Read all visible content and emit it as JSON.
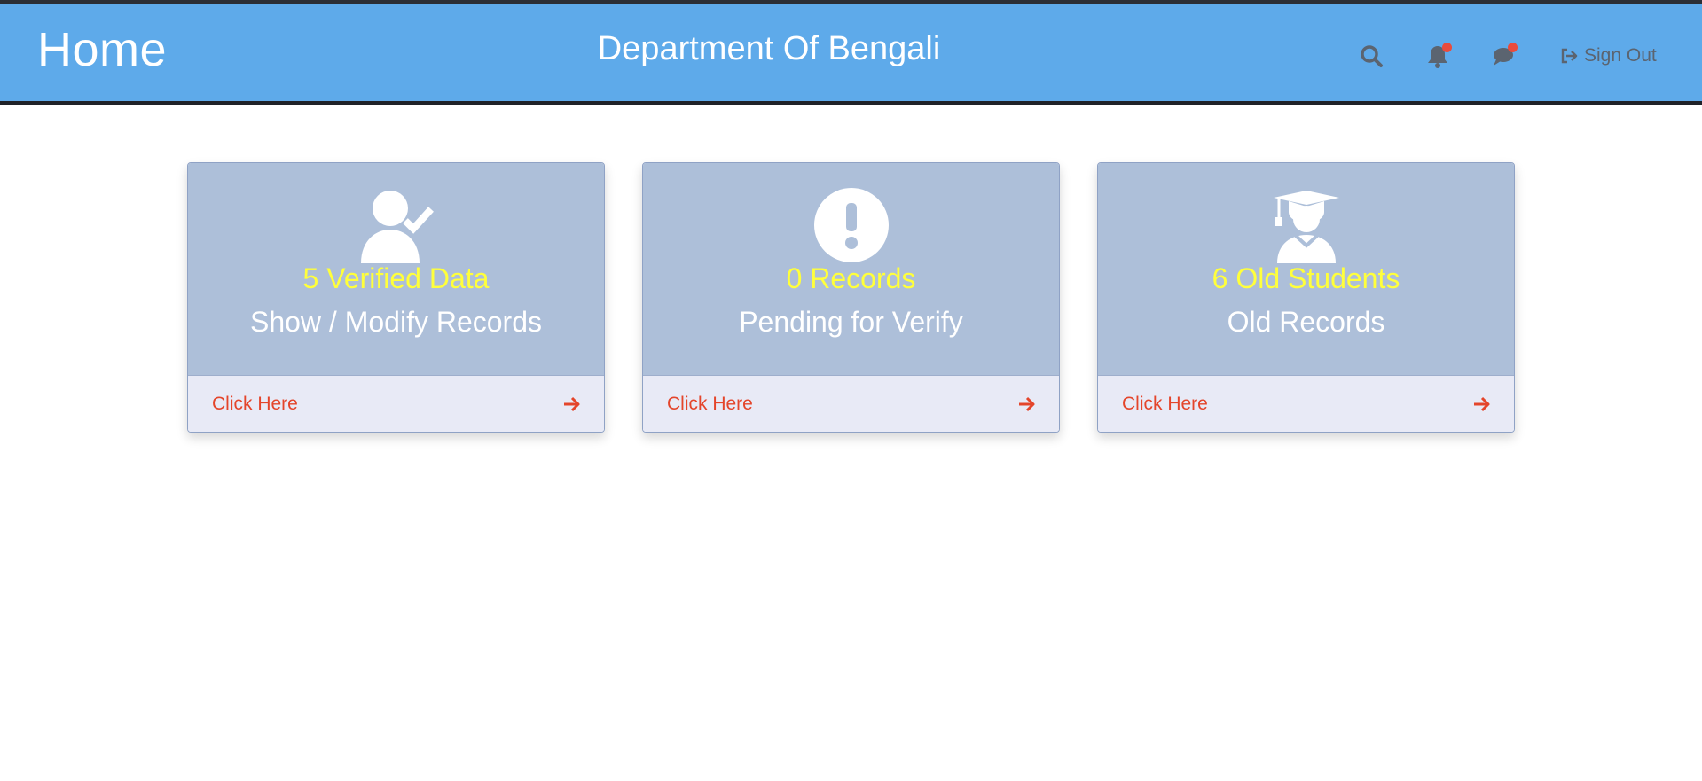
{
  "header": {
    "page_title": "Home",
    "department": "Department Of Bengali",
    "signout_label": "Sign Out",
    "icons": [
      "search-icon",
      "bell-icon",
      "chat-icon",
      "sign-out-icon"
    ],
    "bar_color": "#5eaaea"
  },
  "cards": [
    {
      "icon": "user-check-icon",
      "count": "5 Verified Data",
      "caption": "Show / Modify Records",
      "link": "Click Here"
    },
    {
      "icon": "exclamation-circle-icon",
      "count": "0 Records",
      "caption": "Pending for Verify",
      "link": "Click Here"
    },
    {
      "icon": "graduate-icon",
      "count": "6 Old Students",
      "caption": "Old Records",
      "link": "Click Here"
    }
  ],
  "colors": {
    "card_bg": "#adbfd9",
    "count_text": "#ffff3b",
    "link_text": "#e4452b",
    "notification_dot": "#e94b3c"
  }
}
